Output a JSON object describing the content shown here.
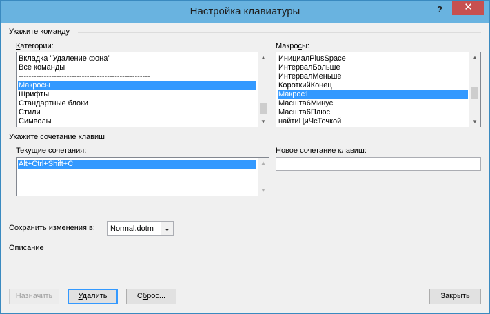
{
  "window": {
    "title": "Настройка клавиатуры",
    "help_label": "?",
    "close_label": "✕"
  },
  "command_group": {
    "label": "Укажите команду",
    "categories": {
      "label": "Категории:",
      "items": [
        "Вкладка \"Удаление фона\"",
        "Все команды",
        "----------------------------------------------------",
        "Макросы",
        "Шрифты",
        "Стандартные блоки",
        "Стили",
        "Символы"
      ],
      "selected_index": 3
    },
    "macros": {
      "label": "Макросы:",
      "items": [
        "ИнициалPlusSpace",
        "ИнтервалБольше",
        "ИнтервалМеньше",
        "КороткийКонец",
        "Макрос1",
        "Масшта6Минус",
        "Масшта6Плюс",
        "найтиЦиЧсТочкой"
      ],
      "selected_index": 4
    }
  },
  "shortcut_group": {
    "label": "Укажите сочетание клавиш",
    "current": {
      "label": "Текущие сочетания:",
      "items": [
        "Alt+Ctrl+Shift+C"
      ],
      "selected_index": 0
    },
    "new_shortcut": {
      "label": "Новое сочетание клавиш:",
      "value": ""
    }
  },
  "save_in": {
    "label": "Сохранить изменения в:",
    "value": "Normal.dotm"
  },
  "description": {
    "label": "Описание"
  },
  "buttons": {
    "assign": "Назначить",
    "remove": "Удалить",
    "reset": "Сброс...",
    "close": "Закрыть"
  },
  "colors": {
    "titlebar": "#69b3e0",
    "selection": "#3399ff",
    "close": "#c75050"
  }
}
